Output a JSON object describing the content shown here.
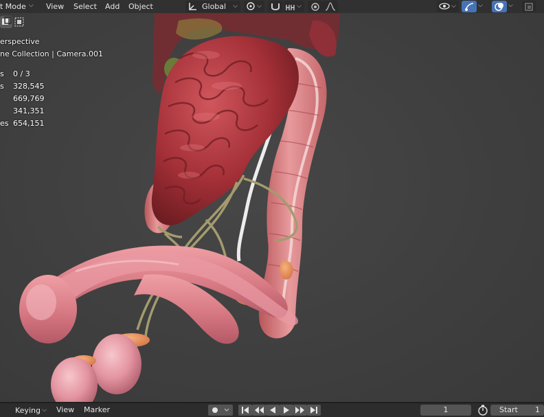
{
  "header": {
    "mode_label": "t Mode",
    "menu": [
      "View",
      "Select",
      "Add",
      "Object"
    ],
    "transform_orientation": "Global"
  },
  "overlay": {
    "view_name": "erspective",
    "collection_camera": "ne Collection | Camera.001",
    "stats": [
      {
        "key": "s",
        "value": "0 / 3"
      },
      {
        "key": "s",
        "value": "328,545"
      },
      {
        "key": "",
        "value": "669,769"
      },
      {
        "key": "",
        "value": "341,351"
      },
      {
        "key": "es",
        "value": "654,151"
      }
    ]
  },
  "footer": {
    "keying_label": "Keying",
    "view_label": "View",
    "marker_label": "Marker",
    "current_frame": "1",
    "start_label": "Start",
    "start_value": "1"
  },
  "colors": {
    "header_bg": "#303030",
    "viewport_bg": "#3f3f3f",
    "active_button": "#4772b3",
    "intestine": "#a8343c",
    "colon": "#d9787c",
    "nerve": "#a49b6e"
  },
  "icons": [
    "cursor-icon",
    "transform-pivot-icon",
    "snap-icon",
    "snap-increment-icon",
    "proportional-edit-icon",
    "falloff-icon",
    "visibility-icon",
    "gizmo-icon",
    "overlay-icon",
    "xray-icon",
    "keyframe-dot-icon",
    "jump-start-icon",
    "prev-keyframe-icon",
    "play-reverse-icon",
    "play-icon",
    "next-keyframe-icon",
    "jump-end-icon",
    "stopwatch-icon"
  ]
}
